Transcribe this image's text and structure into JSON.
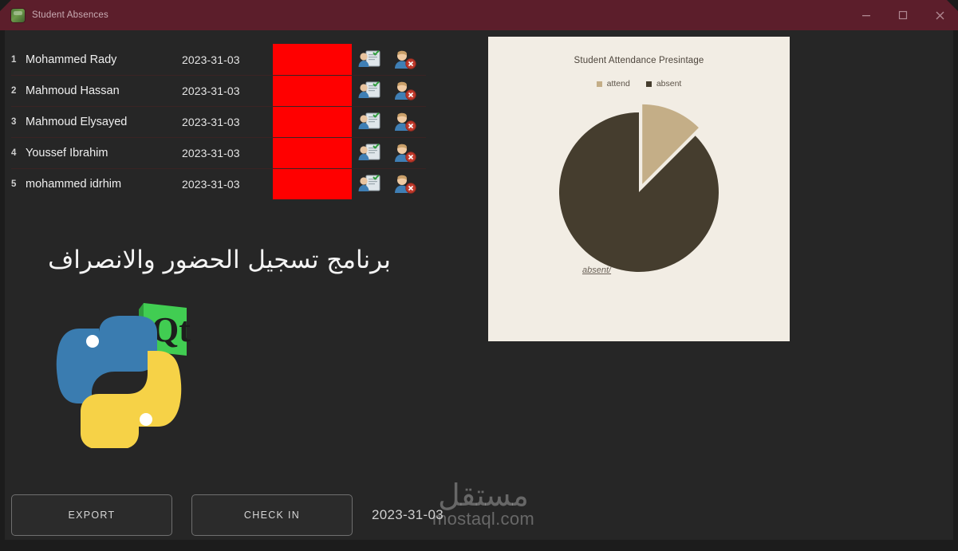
{
  "window": {
    "title": "Student Absences",
    "icon": "app-icon",
    "titlebar_color": "#5C1E2B",
    "background_color": "#262626",
    "controls": {
      "minimize": "minimize-icon",
      "maximize": "maximize-icon",
      "close": "close-icon"
    }
  },
  "student_table": {
    "status_color": "#FF0000",
    "rows": [
      {
        "index": "1",
        "name": "Mohammed Rady",
        "date": "2023-31-03",
        "status": "",
        "action_checkin": "check-in-icon",
        "action_absent": "mark-absent-icon"
      },
      {
        "index": "2",
        "name": "Mahmoud Hassan",
        "date": "2023-31-03",
        "status": "",
        "action_checkin": "check-in-icon",
        "action_absent": "mark-absent-icon"
      },
      {
        "index": "3",
        "name": "Mahmoud Elysayed",
        "date": "2023-31-03",
        "status": "",
        "action_checkin": "check-in-icon",
        "action_absent": "mark-absent-icon"
      },
      {
        "index": "4",
        "name": "Youssef Ibrahim",
        "date": "2023-31-03",
        "status": "",
        "action_checkin": "check-in-icon",
        "action_absent": "mark-absent-icon"
      },
      {
        "index": "5",
        "name": "mohammed idrhim",
        "date": "2023-31-03",
        "status": "",
        "action_checkin": "check-in-icon",
        "action_absent": "mark-absent-icon"
      }
    ]
  },
  "caption": {
    "arabic": "برنامج تسجيل الحضور والانصراف"
  },
  "logos": {
    "python": "python-logo",
    "qt": "Qt"
  },
  "chart_data": {
    "type": "pie",
    "title": "Student Attendance Presintage",
    "categories": [
      "attend",
      "absent"
    ],
    "values": [
      12.5,
      87.5
    ],
    "colors": [
      "#C4AE87",
      "#453D2E"
    ],
    "legend": [
      "attend",
      "absent"
    ],
    "legend_position": "top",
    "annotations": [
      "absent/"
    ],
    "panel_background": "#F2EDE4",
    "xlabel": "",
    "ylabel": ""
  },
  "bottom": {
    "export_label": "EXPORT",
    "checkin_label": "CHECK IN",
    "date": "2023-31-03"
  },
  "watermark": {
    "arabic": "مستقل",
    "latin": "mostaql.com"
  }
}
